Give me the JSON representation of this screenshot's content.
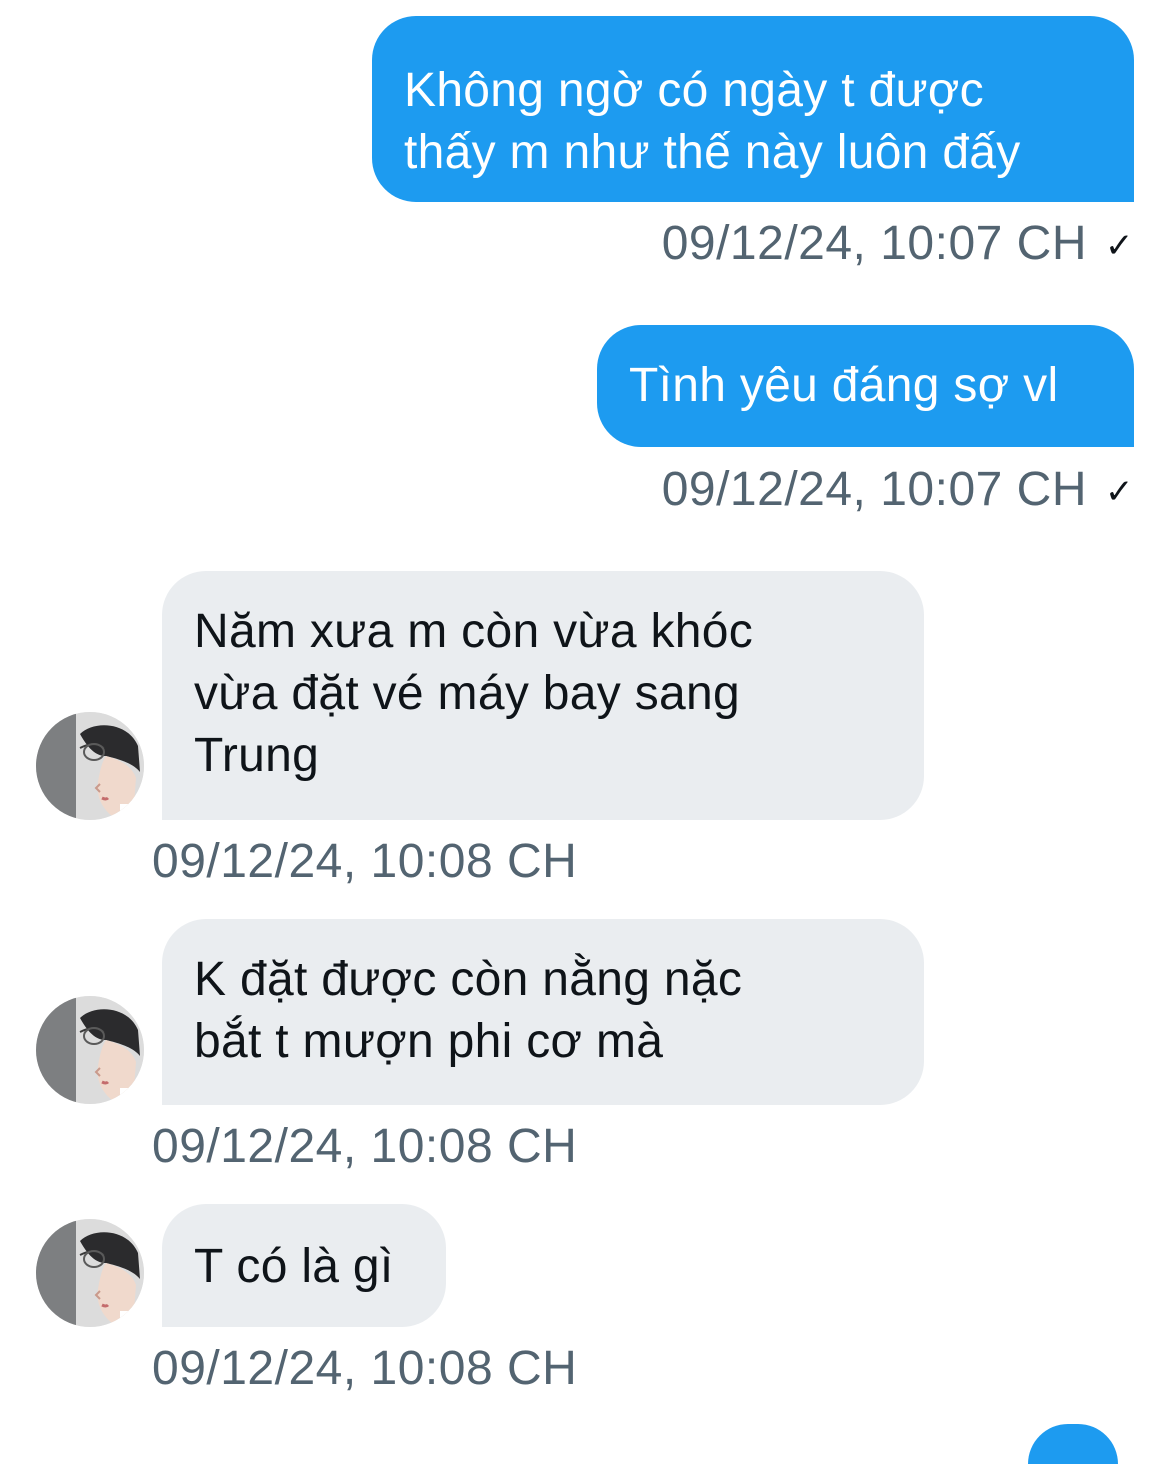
{
  "messages": [
    {
      "direction": "outgoing",
      "text": "Không ngờ có ngày t được\nthấy m như thế này luôn đấy",
      "timestamp": "09/12/24, 10:07 CH",
      "status_icon": "check-icon"
    },
    {
      "direction": "outgoing",
      "text": "Tình yêu đáng sợ vl",
      "timestamp": "09/12/24, 10:07 CH",
      "status_icon": "check-icon"
    },
    {
      "direction": "incoming",
      "text": "Năm xưa m còn vừa khóc\nvừa đặt vé máy bay sang\nTrung",
      "timestamp": "09/12/24, 10:08 CH"
    },
    {
      "direction": "incoming",
      "text": "K đặt được còn nằng nặc\nbắt t mượn phi cơ mà",
      "timestamp": "09/12/24, 10:08 CH"
    },
    {
      "direction": "incoming",
      "text": "T có là gì",
      "timestamp": "09/12/24, 10:08 CH"
    }
  ],
  "colors": {
    "outgoing_bubble": "#1d9bf0",
    "incoming_bubble": "#eaedf0",
    "timestamp_text": "#536471"
  }
}
